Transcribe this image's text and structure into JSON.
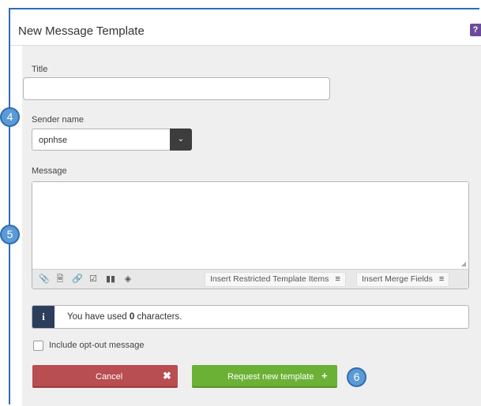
{
  "dialog": {
    "title": "New Message Template",
    "help_label": "?"
  },
  "form": {
    "title_label": "Title",
    "title_value": "",
    "sender_label": "Sender name",
    "sender_value": "opnhse",
    "message_label": "Message",
    "message_value": ""
  },
  "toolbar": {
    "icons": [
      "paperclip-icon",
      "document-icon",
      "link-icon",
      "checkbox-icon",
      "barcode-icon",
      "tag-icon"
    ],
    "insert_restricted_label": "Insert Restricted Template Items",
    "insert_merge_label": "Insert Merge Fields"
  },
  "info": {
    "prefix": "You have used ",
    "count": "0",
    "suffix": " characters."
  },
  "options": {
    "opt_out_label": "Include opt-out message",
    "opt_out_checked": false
  },
  "actions": {
    "cancel_label": "Cancel",
    "request_label": "Request new template"
  },
  "annotations": {
    "badge_sender": "4",
    "badge_message": "5",
    "badge_request": "6"
  },
  "colors": {
    "header_border": "#2f6db5",
    "cancel": "#b84d52",
    "request": "#6bb136",
    "info_icon": "#2c3e5c",
    "help": "#6b4c9a",
    "badge": "#5b9bd5"
  }
}
